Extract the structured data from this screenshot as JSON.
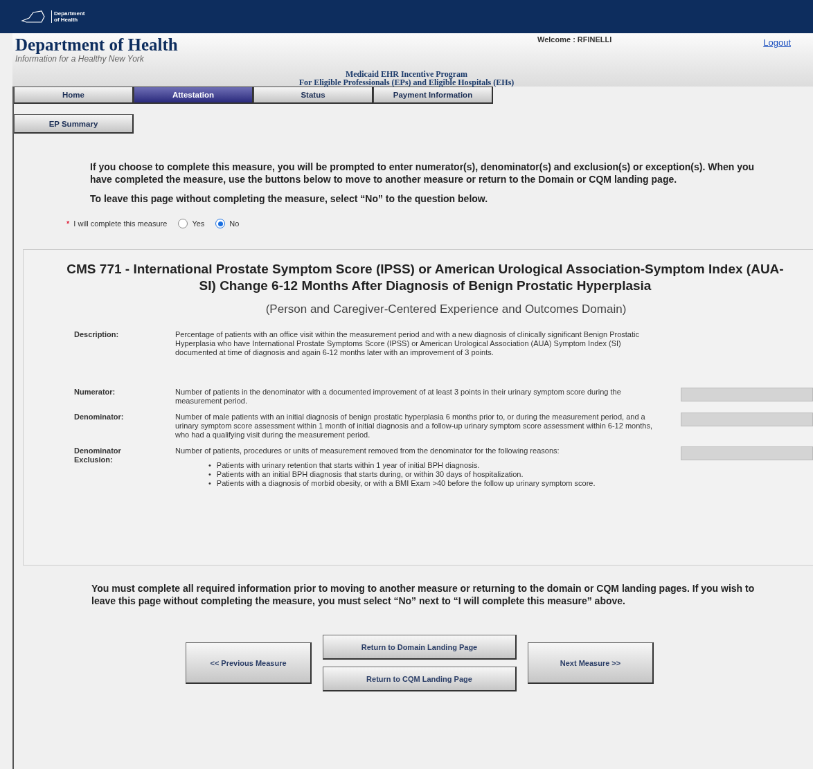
{
  "top_bar": {
    "logo_lines": [
      "Department",
      "of Health"
    ]
  },
  "header": {
    "title": "Department of Health",
    "tagline": "Information for a Healthy New York",
    "welcome": "Welcome : RFINELLI",
    "logout": "Logout",
    "program_lines": [
      "Medicaid EHR Incentive Program",
      "For Eligible Professionals (EPs) and Eligible Hospitals (EHs)"
    ]
  },
  "tabs": [
    {
      "label": "Home",
      "selected": false
    },
    {
      "label": "Attestation",
      "selected": true
    },
    {
      "label": "Status",
      "selected": false
    },
    {
      "label": "Payment Information",
      "selected": false
    }
  ],
  "sub_tab": "EP Summary",
  "intro": [
    "If you choose to complete this measure, you will be prompted to enter numerator(s), denominator(s) and exclusion(s) or exception(s). When you have completed the measure, use the buttons below to move to another measure or return to the Domain or CQM landing page.",
    "To leave this page without completing the measure, select “No” to the question below."
  ],
  "question": {
    "required_mark": "*",
    "label": "I will complete this measure",
    "options": [
      {
        "label": "Yes",
        "selected": false
      },
      {
        "label": "No",
        "selected": true
      }
    ]
  },
  "measure": {
    "title": "CMS 771 - International Prostate Symptom Score (IPSS) or American Urological Association-Symptom Index (AUA-SI) Change 6-12 Months After Diagnosis of Benign Prostatic Hyperplasia",
    "domain": "(Person and Caregiver-Centered Experience and Outcomes Domain)",
    "rows": [
      {
        "kind": "text",
        "label": "Description:",
        "text": "Percentage of patients with an office visit within the measurement period and with a new diagnosis of clinically significant Benign Prostatic Hyperplasia who have International Prostate Symptoms Score (IPSS) or American Urological Association (AUA) Symptom Index (SI) documented at time of diagnosis and again 6-12 months later with an improvement of 3 points."
      },
      {
        "kind": "entry",
        "label": "Numerator:",
        "text": "Number of patients in the denominator with a documented improvement of at least 3 points in their urinary symptom score during the measurement period."
      },
      {
        "kind": "entry",
        "label": "Denominator:",
        "text": "Number of male patients with an initial diagnosis of benign prostatic hyperplasia 6 months prior to, or during the measurement period, and a urinary symptom score assessment within 1 month of initial diagnosis and a follow-up urinary symptom score assessment within 6-12 months, who had a qualifying visit during the measurement period."
      },
      {
        "kind": "entry",
        "label": "Denominator Exclusion:",
        "text": "Number of patients, procedures or units of measurement removed from the denominator for the following reasons:",
        "bullet_mark": "•",
        "bullets": [
          "Patients with urinary retention that starts within 1 year of initial BPH diagnosis.",
          "Patients with an initial BPH diagnosis that starts during, or within 30 days of hospitalization.",
          "Patients with a diagnosis of morbid obesity, or with a BMI Exam >40 before the follow up urinary symptom score."
        ]
      }
    ]
  },
  "footer_note": "You must complete all required information prior to moving to another measure or returning to the domain or CQM landing pages. If you wish to leave this page without completing the measure, you must select “No” next to “I will complete this measure” above.",
  "buttons": {
    "previous": "<< Previous Measure",
    "return_domain": "Return to Domain Landing Page",
    "return_cqm": "Return to CQM Landing Page",
    "next": "Next Measure >>"
  }
}
